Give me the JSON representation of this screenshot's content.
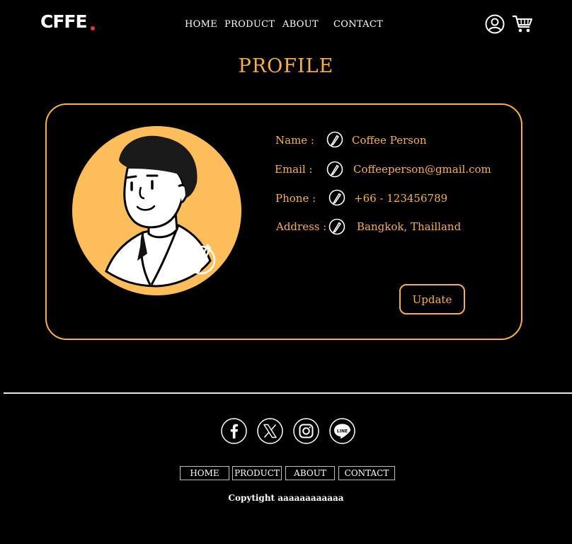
{
  "header": {
    "logo": "CFFE",
    "nav": [
      "HOME",
      "PRODUCT",
      "ABOUT",
      "CONTACT"
    ],
    "icons": [
      "user-icon",
      "cart-icon"
    ]
  },
  "page": {
    "title": "PROFILE"
  },
  "profile": {
    "fields": [
      {
        "label": "Name :",
        "value": "Coffee Person"
      },
      {
        "label": "Email :",
        "value": "Coffeeperson@gmail.com"
      },
      {
        "label": "Phone :",
        "value": "+66 - 123456789"
      },
      {
        "label": "Address :",
        "value": "Bangkok, Thailland"
      }
    ],
    "update_label": "Update"
  },
  "footer": {
    "social": [
      "facebook-icon",
      "x-icon",
      "instagram-icon",
      "line-icon"
    ],
    "nav": [
      "HOME",
      "PRODUCT",
      "ABOUT",
      "CONTACT"
    ],
    "line_text": "LINE",
    "copyright": "Copytight aaaaaaaaaaaa"
  },
  "colors": {
    "accent": "#f6b14e",
    "background": "#000000",
    "logo_dot": "#e53935"
  }
}
